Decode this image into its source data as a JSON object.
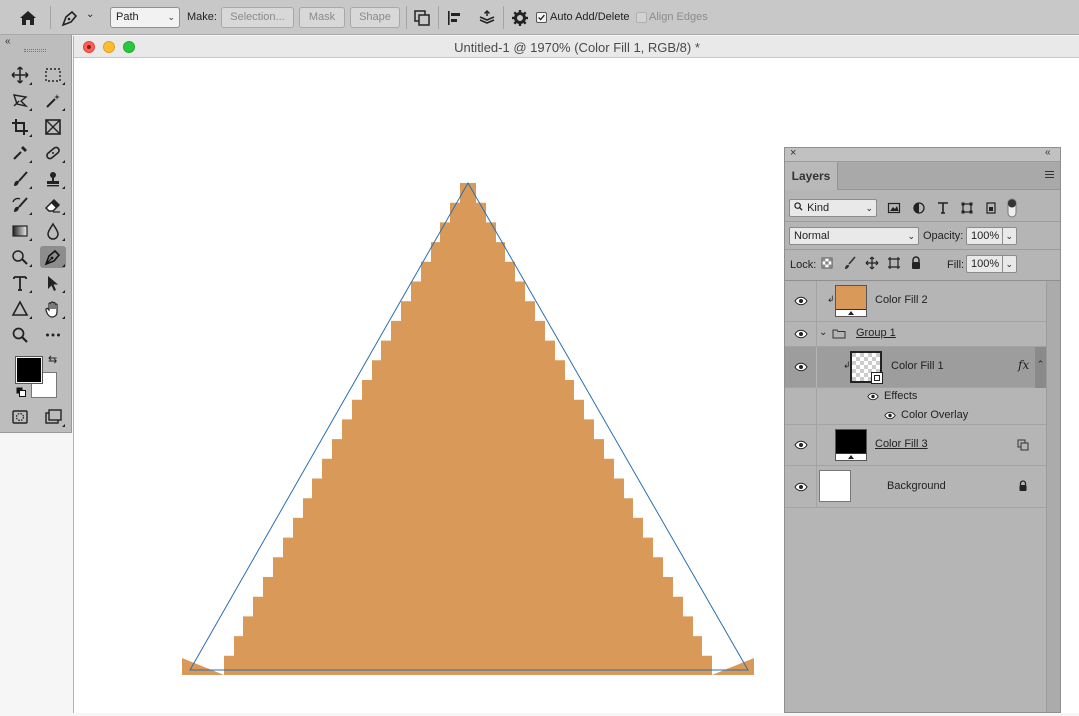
{
  "options_bar": {
    "tool_mode": "Path",
    "make_label": "Make:",
    "selection_button": "Selection...",
    "mask_button": "Mask",
    "shape_button": "Shape",
    "auto_add_delete_label": "Auto Add/Delete",
    "auto_add_delete_checked": true,
    "align_edges_label": "Align Edges",
    "align_edges_checked": false
  },
  "document": {
    "title": "Untitled-1 @ 1970% (Color Fill 1, RGB/8) *",
    "fill_color": "#d99a59",
    "path_color": "#2a6fb0"
  },
  "colors": {
    "foreground": "#000000",
    "background": "#ffffff"
  },
  "layers_panel": {
    "tab_label": "Layers",
    "filter_kind": "Kind",
    "blend_mode": "Normal",
    "opacity_label": "Opacity:",
    "opacity_value": "100%",
    "lock_label": "Lock:",
    "fill_label": "Fill:",
    "fill_value": "100%",
    "layers": [
      {
        "name": "Color Fill 2",
        "thumb_color": "#d99a59"
      },
      {
        "name": "Group 1"
      },
      {
        "name": "Color Fill 1",
        "fx": "fx",
        "effects_label": "Effects",
        "effect_name": "Color Overlay"
      },
      {
        "name": "Color Fill 3",
        "thumb_color": "#000000"
      },
      {
        "name": "Background",
        "thumb_color": "#ffffff"
      }
    ]
  }
}
